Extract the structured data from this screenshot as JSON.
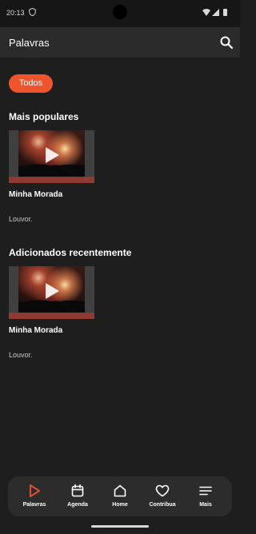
{
  "status_bar": {
    "time": "20:13",
    "icons": [
      "shield-icon",
      "wifi-icon",
      "signal-icon",
      "battery-icon"
    ]
  },
  "app_bar": {
    "title": "Palavras",
    "search_icon": "search-icon"
  },
  "filter": {
    "chip_label": "Todos",
    "chip_color": "#f0542d"
  },
  "sections": [
    {
      "title": "Mais populares",
      "items": [
        {
          "title": "Minha Morada",
          "subtitle": "Louvor."
        }
      ]
    },
    {
      "title": "Adicionados recentemente",
      "items": [
        {
          "title": "Minha Morada",
          "subtitle": "Louvor."
        }
      ]
    }
  ],
  "bottom_nav": {
    "active_color": "#f0542d",
    "items": [
      {
        "label": "Palavras",
        "icon": "play-outline-icon",
        "active": true
      },
      {
        "label": "Agenda",
        "icon": "calendar-icon",
        "active": false
      },
      {
        "label": "Home",
        "icon": "home-icon",
        "active": false
      },
      {
        "label": "Contribua",
        "icon": "heart-icon",
        "active": false
      },
      {
        "label": "Mais",
        "icon": "menu-icon",
        "active": false
      }
    ]
  }
}
